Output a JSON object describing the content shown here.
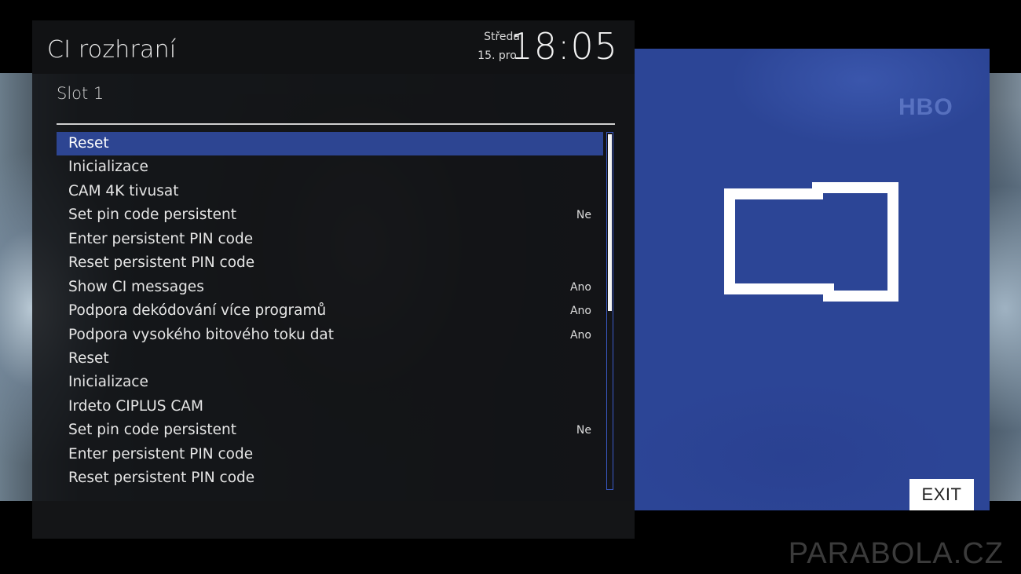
{
  "header": {
    "title": "CI rozhraní",
    "day_name": "Středa",
    "date": "15. pro.",
    "time": "18:05"
  },
  "section": {
    "subtitle": "Slot  1"
  },
  "menu": {
    "selected_index": 0,
    "items": [
      {
        "label": "Reset",
        "value": ""
      },
      {
        "label": "Inicializace",
        "value": ""
      },
      {
        "label": "CAM 4K tivusat",
        "value": ""
      },
      {
        "label": "Set pin code persistent",
        "value": "Ne"
      },
      {
        "label": "Enter persistent PIN code",
        "value": ""
      },
      {
        "label": "Reset persistent PIN code",
        "value": ""
      },
      {
        "label": "Show CI messages",
        "value": "Ano"
      },
      {
        "label": "Podpora dekódování více programů",
        "value": "Ano"
      },
      {
        "label": "Podpora vysokého bitového toku dat",
        "value": "Ano"
      },
      {
        "label": "Reset",
        "value": ""
      },
      {
        "label": "Inicializace",
        "value": ""
      },
      {
        "label": "Irdeto CIPLUS CAM",
        "value": ""
      },
      {
        "label": "Set pin code persistent",
        "value": "Ne"
      },
      {
        "label": "Enter persistent PIN code",
        "value": ""
      },
      {
        "label": "Reset persistent PIN code",
        "value": ""
      }
    ]
  },
  "preview": {
    "channel_logo": "HBO",
    "icon": "ci-slot-icon",
    "exit_label": "EXIT"
  },
  "watermark": "PARABOLA.CZ",
  "colors": {
    "selection": "#2d4592",
    "preview_bg": "#2c4596",
    "panel_bg": "#121315"
  }
}
